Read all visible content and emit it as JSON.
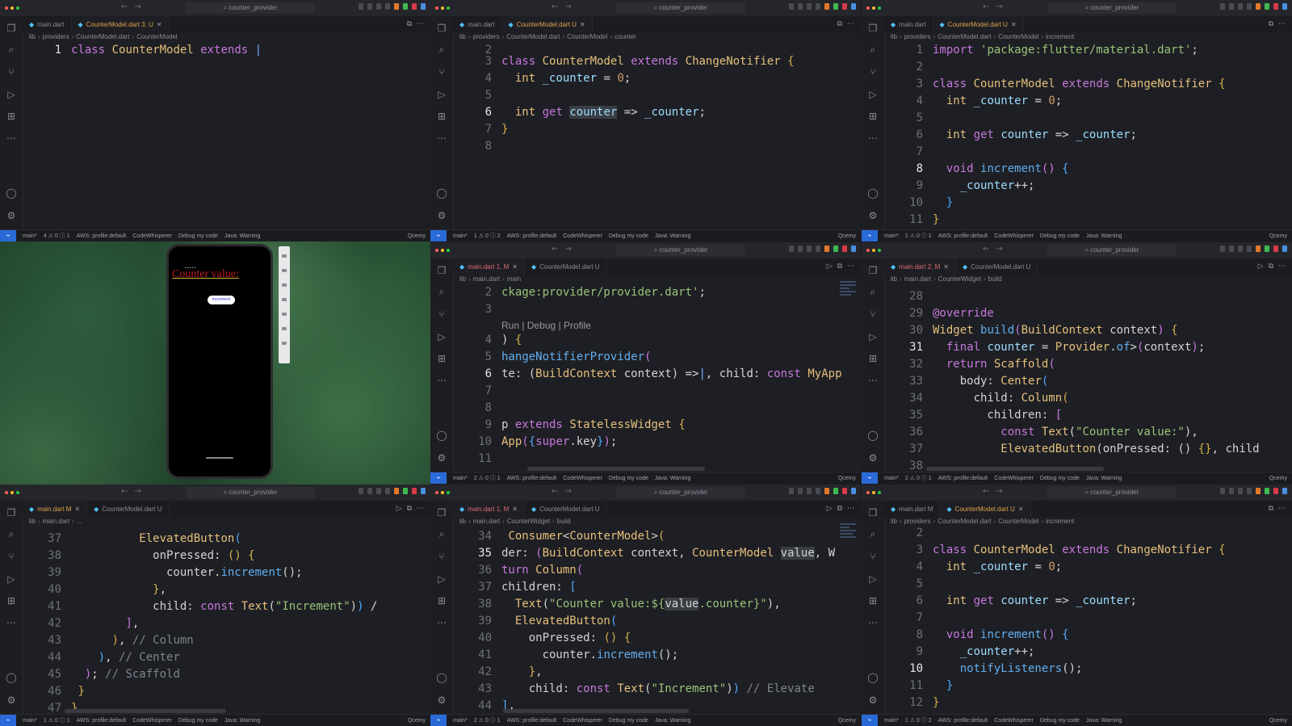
{
  "common": {
    "search": "counter_provider",
    "status": {
      "branch": "main*",
      "aws": "AWS: profile:default",
      "codewhisperer": "CodeWhisperer",
      "debug": "Debug my code",
      "java": "Java: Warning",
      "right": "Qcemy"
    },
    "icons": [
      "explorer-icon",
      "search-icon",
      "source-control-icon",
      "run-debug-icon",
      "extensions-icon",
      "more-icon",
      "account-icon",
      "settings-icon"
    ]
  },
  "p1": {
    "tabs": [
      {
        "label": "main.dart",
        "active": false
      },
      {
        "label": "CounterModel.dart 3, U",
        "active": true
      }
    ],
    "crumbs": [
      "lib",
      "providers",
      "CounterModel.dart",
      "CounterModel"
    ],
    "problems": "4 ⚠ 0 ⓘ 1",
    "ports": "0"
  },
  "p2": {
    "tabs": [
      {
        "label": "main.dart",
        "active": false
      },
      {
        "label": "CounterModel.dart U",
        "active": true
      }
    ],
    "crumbs": [
      "lib",
      "providers",
      "CounterModel.dart",
      "CounterModel",
      "counter"
    ],
    "problems": "1 ⚠ 0 ⓘ 2",
    "ports": "0"
  },
  "p3": {
    "tabs": [
      {
        "label": "main.dart",
        "active": false
      },
      {
        "label": "CounterModel.dart U",
        "active": true
      }
    ],
    "crumbs": [
      "lib",
      "providers",
      "CounterModel.dart",
      "CounterModel",
      "increment"
    ],
    "problems": "1 ⚠ 0 ⓘ 1",
    "ports": "0"
  },
  "p4": {
    "phone_label": "Counter value:",
    "button": "Increment"
  },
  "p5": {
    "tabs": [
      {
        "label": "main.dart 1, M",
        "active": true
      },
      {
        "label": "CounterModel.dart U",
        "active": false
      }
    ],
    "crumbs": [
      "lib",
      "main.dart",
      "main"
    ],
    "codelens": "Run | Debug | Profile",
    "problems": "2 ⚠ 0 ⓘ 1",
    "ports": "0"
  },
  "p6": {
    "tabs": [
      {
        "label": "main.dart 2, M",
        "active": true
      },
      {
        "label": "CounterModel.dart U",
        "active": false
      }
    ],
    "crumbs": [
      "lib",
      "main.dart",
      "CounterWidget",
      "build"
    ],
    "problems": "2 ⚠ 0 ⓘ 1",
    "ports": "0"
  },
  "p7": {
    "tabs": [
      {
        "label": "main.dart M",
        "active": true
      },
      {
        "label": "CounterModel.dart U",
        "active": false
      }
    ],
    "crumbs": [
      "lib",
      "main.dart",
      "..."
    ],
    "problems": "1 ⚠ 0 ⓘ 1",
    "ports": "0"
  },
  "p8": {
    "tabs": [
      {
        "label": "main.dart 1, M",
        "active": true
      },
      {
        "label": "CounterModel.dart U",
        "active": false
      }
    ],
    "crumbs": [
      "lib",
      "main.dart",
      "CounterWidget",
      "build"
    ],
    "problems": "2 ⚠ 0 ⓘ 1",
    "ports": "0"
  },
  "p9": {
    "tabs": [
      {
        "label": "main.dart M",
        "active": false
      },
      {
        "label": "CounterModel.dart U",
        "active": true
      }
    ],
    "crumbs": [
      "lib",
      "providers",
      "CounterModel.dart",
      "CounterModel",
      "increment"
    ],
    "problems": "1 ⚠ 0 ⓘ 2",
    "ports": "0"
  }
}
